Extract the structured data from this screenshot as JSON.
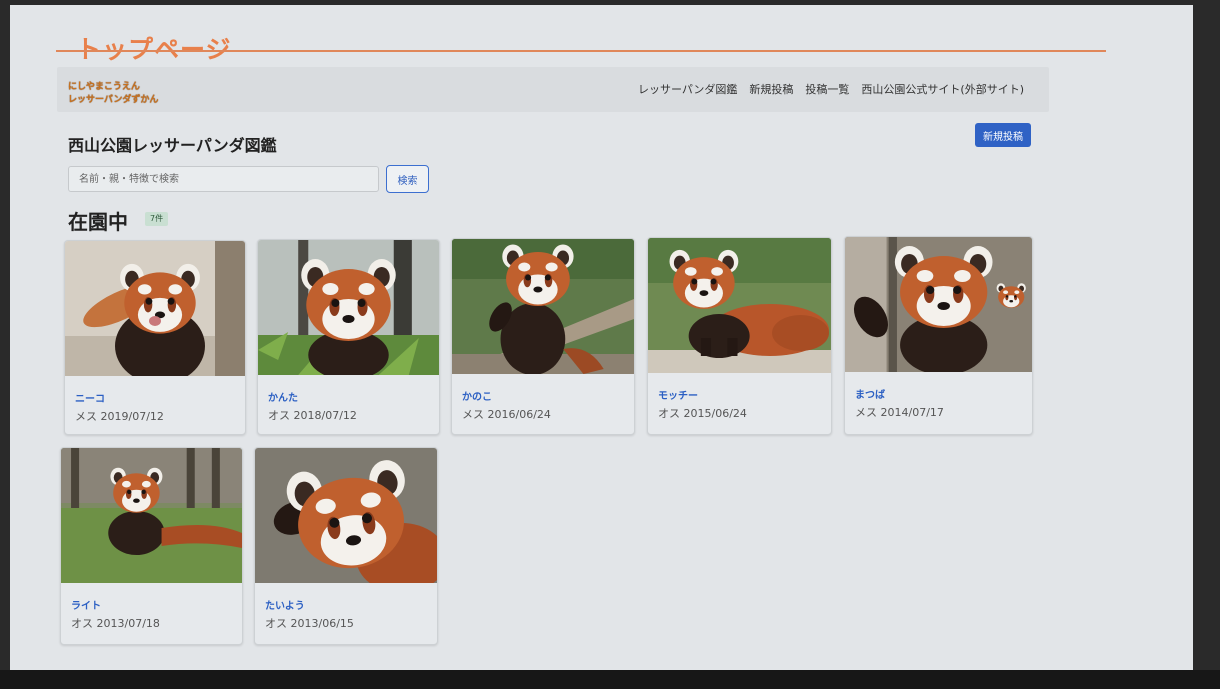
{
  "page": {
    "title": "トップページ"
  },
  "navbar": {
    "logo_line1": "にしやまこうえん",
    "logo_line2": "レッサーパンダずかん",
    "links": [
      "レッサーパンダ図鑑",
      "新規投稿",
      "投稿一覧",
      "西山公園公式サイト(外部サイト)"
    ]
  },
  "main": {
    "heading": "西山公園レッサーパンダ図鑑",
    "new_post_label": "新規投稿",
    "search": {
      "placeholder": "名前・親・特徴で検索",
      "value": "",
      "button_label": "検索"
    },
    "section_title": "在園中",
    "count_badge": "7件"
  },
  "pandas": [
    {
      "name": "ニーコ",
      "info": "メス 2019/07/12"
    },
    {
      "name": "かんた",
      "info": "オス 2018/07/12"
    },
    {
      "name": "かのこ",
      "info": "メス 2016/06/24"
    },
    {
      "name": "モッチー",
      "info": "オス 2015/06/24"
    },
    {
      "name": "まつば",
      "info": "メス 2014/07/17"
    },
    {
      "name": "ライト",
      "info": "オス 2013/07/18"
    },
    {
      "name": "たいよう",
      "info": "オス 2013/06/15"
    }
  ],
  "colors": {
    "title": "#e8804b",
    "accent_blue": "#2f62c5",
    "panda_fur": "#b8562a",
    "panda_dark": "#2b1e18"
  }
}
